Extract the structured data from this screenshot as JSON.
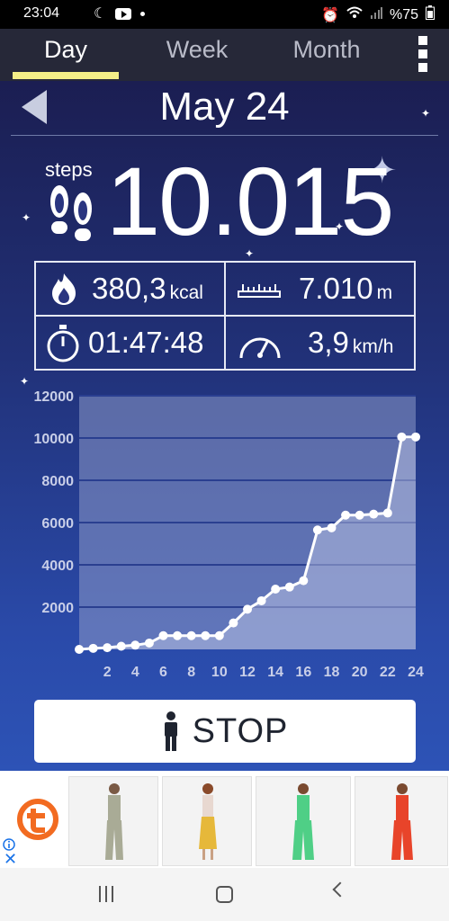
{
  "status_bar": {
    "time": "23:04",
    "battery": "%75"
  },
  "tabs": [
    {
      "label": "Day",
      "active": true
    },
    {
      "label": "Week",
      "active": false
    },
    {
      "label": "Month",
      "active": false
    }
  ],
  "header": {
    "date": "May 24"
  },
  "steps": {
    "label": "steps",
    "value": "10.015"
  },
  "stats": {
    "calories": {
      "value": "380,3",
      "unit": "kcal"
    },
    "distance": {
      "value": "7.010",
      "unit": "m"
    },
    "duration": {
      "value": "01:47:48"
    },
    "speed": {
      "value": "3,9",
      "unit": "km/h"
    }
  },
  "chart_data": {
    "type": "area",
    "x": [
      0,
      1,
      2,
      3,
      4,
      5,
      6,
      7,
      8,
      9,
      10,
      11,
      12,
      13,
      14,
      15,
      16,
      17,
      18,
      19,
      20,
      21,
      22,
      23,
      24
    ],
    "values": [
      0,
      50,
      80,
      150,
      200,
      300,
      650,
      650,
      650,
      650,
      650,
      1250,
      1900,
      2300,
      2850,
      2950,
      3250,
      5650,
      5750,
      6350,
      6350,
      6400,
      6450,
      10050,
      10050
    ],
    "x_ticks": [
      2,
      4,
      6,
      8,
      10,
      12,
      14,
      16,
      18,
      20,
      22,
      24
    ],
    "y_ticks": [
      2000,
      4000,
      6000,
      8000,
      10000,
      12000
    ],
    "ylim": [
      0,
      12000
    ],
    "xlim": [
      0,
      24
    ],
    "grid": true,
    "line_color": "#ffffff",
    "fill_color": "#8c99c9"
  },
  "stop_button": {
    "label": "STOP"
  },
  "colors": {
    "tab_underline": "#f4ef88",
    "tab_bar": "#262838"
  }
}
